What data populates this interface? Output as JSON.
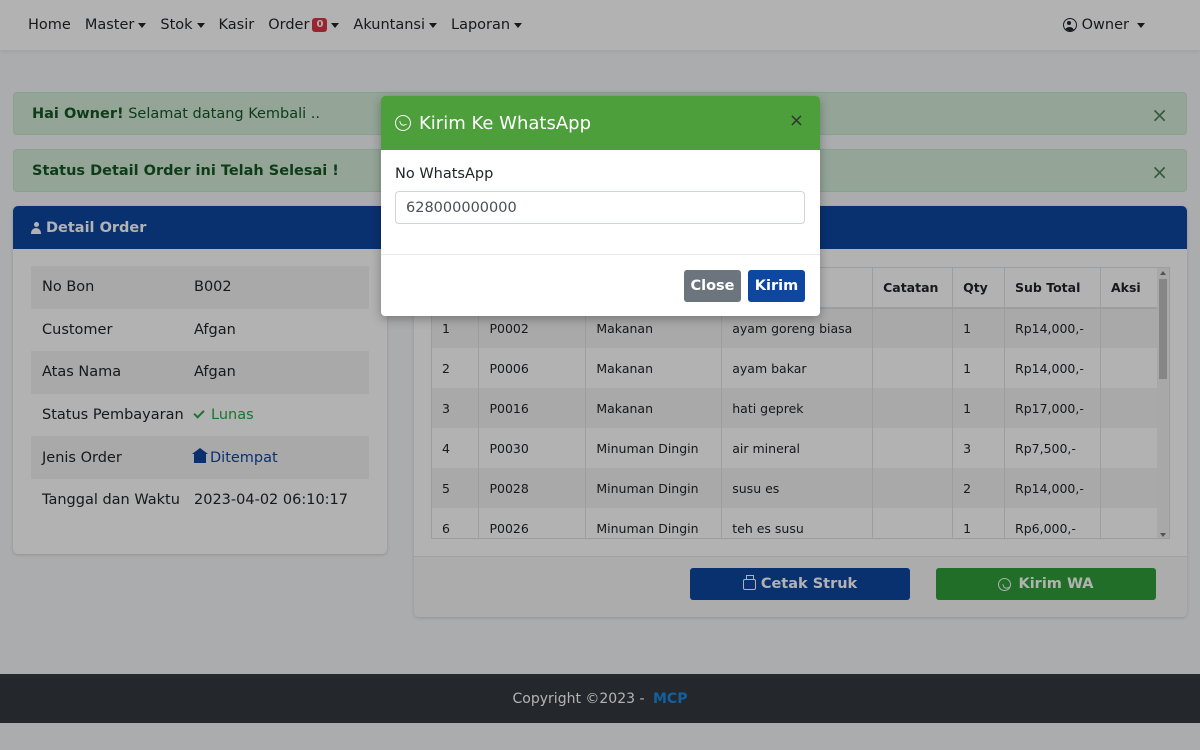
{
  "navbar": {
    "items": [
      {
        "label": "Home"
      },
      {
        "label": "Master"
      },
      {
        "label": "Stok"
      },
      {
        "label": "Kasir"
      },
      {
        "label": "Order",
        "badge": "0"
      },
      {
        "label": "Akuntansi"
      },
      {
        "label": "Laporan"
      }
    ],
    "user": "Owner"
  },
  "alerts": [
    {
      "strong": "Hai Owner!",
      "text": " Selamat datang Kembali .."
    },
    {
      "strong": "Status Detail Order ini Telah Selesai !",
      "text": ""
    }
  ],
  "detail": {
    "title": "Detail Order",
    "rows": [
      {
        "label": "No Bon",
        "value": "B002"
      },
      {
        "label": "Customer",
        "value": "Afgan"
      },
      {
        "label": "Atas Nama",
        "value": "Afgan"
      },
      {
        "label": "Status Pembayaran",
        "value": "Lunas"
      },
      {
        "label": "Jenis Order",
        "value": "Ditempat"
      },
      {
        "label": "Tanggal dan Waktu",
        "value": "2023-04-02 06:10:17"
      }
    ]
  },
  "order_table": {
    "headers": [
      "",
      "",
      "",
      "",
      "Catatan",
      "Qty",
      "Sub Total",
      "Aksi"
    ],
    "rows": [
      [
        "1",
        "P0002",
        "Makanan",
        "ayam goreng biasa",
        "",
        "1",
        "Rp14,000,-",
        ""
      ],
      [
        "2",
        "P0006",
        "Makanan",
        "ayam bakar",
        "",
        "1",
        "Rp14,000,-",
        ""
      ],
      [
        "3",
        "P0016",
        "Makanan",
        "hati geprek",
        "",
        "1",
        "Rp17,000,-",
        ""
      ],
      [
        "4",
        "P0030",
        "Minuman Dingin",
        "air mineral",
        "",
        "3",
        "Rp7,500,-",
        ""
      ],
      [
        "5",
        "P0028",
        "Minuman Dingin",
        "susu es",
        "",
        "2",
        "Rp14,000,-",
        ""
      ],
      [
        "6",
        "P0026",
        "Minuman Dingin",
        "teh es susu",
        "",
        "1",
        "Rp6,000,-",
        ""
      ]
    ]
  },
  "actions": {
    "cetak": "Cetak Struk",
    "kirim_wa": "Kirim WA"
  },
  "modal": {
    "title": "Kirim Ke WhatsApp",
    "label": "No WhatsApp",
    "input_value": "628000000000",
    "close": "Close",
    "kirim": "Kirim"
  },
  "footer": {
    "text": "Copyright ©2023 - ",
    "brand": "MCP"
  },
  "colors": {
    "primary_blue": "#0d47a1",
    "whatsapp_green": "#4c9f3a",
    "success": "#28a745",
    "alert_bg": "#d4edda"
  }
}
